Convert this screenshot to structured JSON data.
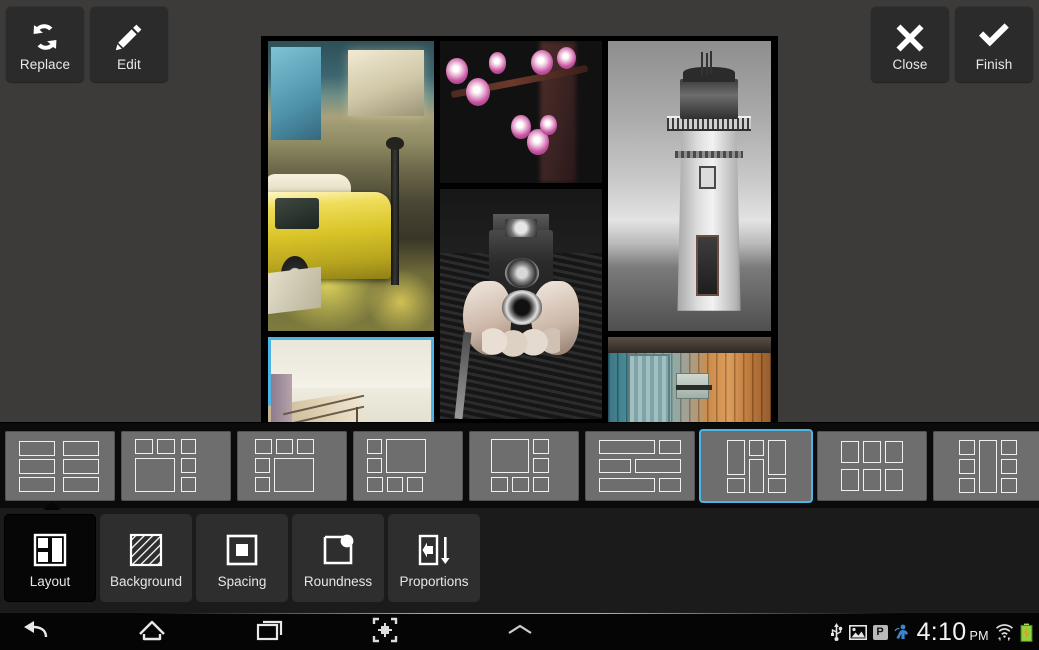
{
  "toolbar": {
    "left_buttons": [
      {
        "name": "replace",
        "label": "Replace",
        "icon": "replace-arrows-icon"
      },
      {
        "name": "edit",
        "label": "Edit",
        "icon": "pencil-icon"
      }
    ],
    "right_buttons": [
      {
        "name": "close",
        "label": "Close",
        "icon": "cross-icon"
      },
      {
        "name": "finish",
        "label": "Finish",
        "icon": "checkmark-icon"
      }
    ]
  },
  "collage": {
    "selected_cell_index": 4,
    "selection_color": "#4db4e6",
    "background_color": "#000000",
    "cells": [
      {
        "name": "photo-yellow-van",
        "description": "Yellow VW van parked on street at dusk",
        "selected": false
      },
      {
        "name": "photo-cherry-blossom",
        "description": "Pink cherry blossoms on branch, teal cross-process",
        "selected": false
      },
      {
        "name": "photo-lighthouse",
        "description": "Black and white lighthouse on rocks",
        "selected": false
      },
      {
        "name": "photo-vintage-camera",
        "description": "Black and white hands holding twin-lens reflex camera",
        "selected": false
      },
      {
        "name": "photo-beach-fence",
        "description": "Faded beach fence and dune",
        "selected": true
      },
      {
        "name": "photo-weathered-door",
        "description": "Weathered teal and orange wooden shed door",
        "selected": false
      }
    ]
  },
  "layout_strip": {
    "selected_index": 6,
    "selection_color": "#4db4e6",
    "thumbnails": [
      {
        "name": "layout-option-1",
        "label": "2 x 3 grid"
      },
      {
        "name": "layout-option-2",
        "label": "Large square left with side column"
      },
      {
        "name": "layout-option-3",
        "label": "Top row with large square right"
      },
      {
        "name": "layout-option-4",
        "label": "Large square center with side column"
      },
      {
        "name": "layout-option-5",
        "label": "Large square left with right column and bottom row"
      },
      {
        "name": "layout-option-6",
        "label": "Wide bars mixed"
      },
      {
        "name": "layout-option-7",
        "label": "Tall portrait columns"
      },
      {
        "name": "layout-option-8",
        "label": "2 x 3 portrait grid"
      },
      {
        "name": "layout-option-9",
        "label": "Narrow portrait columns"
      }
    ]
  },
  "mode_bar": {
    "active": "Layout",
    "tabs": [
      {
        "name": "layout",
        "label": "Layout",
        "icon": "grid-panes-icon"
      },
      {
        "name": "background",
        "label": "Background",
        "icon": "hatch-pattern-icon"
      },
      {
        "name": "spacing",
        "label": "Spacing",
        "icon": "nested-square-icon"
      },
      {
        "name": "roundness",
        "label": "Roundness",
        "icon": "rounded-corner-icon"
      },
      {
        "name": "proportions",
        "label": "Proportions",
        "icon": "arrow-resize-icon"
      }
    ]
  },
  "system_bar": {
    "nav": [
      {
        "name": "back",
        "icon": "back-arrow-icon"
      },
      {
        "name": "home",
        "icon": "home-icon"
      },
      {
        "name": "recents",
        "icon": "recent-apps-icon"
      },
      {
        "name": "screenshot",
        "icon": "screenshot-icon"
      },
      {
        "name": "collapse",
        "icon": "chevron-up-icon"
      }
    ],
    "status": {
      "time": "4:10",
      "am_pm": "PM",
      "icons": [
        {
          "name": "usb-icon",
          "label": "USB"
        },
        {
          "name": "screenshot-captured-icon",
          "label": "Screenshot saved"
        },
        {
          "name": "parking-badge-icon",
          "label": "P"
        },
        {
          "name": "sync-person-icon",
          "label": "Sync"
        },
        {
          "name": "wifi-icon",
          "label": "Wi-Fi"
        },
        {
          "name": "battery-charging-icon",
          "label": "Battery charging"
        }
      ]
    }
  }
}
